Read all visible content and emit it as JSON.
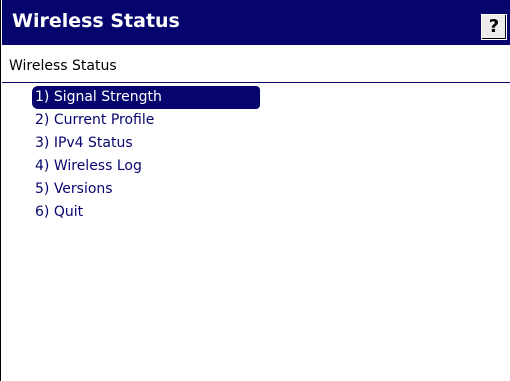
{
  "window": {
    "title": "Wireless Status",
    "help_label": "?"
  },
  "main": {
    "subtitle": "Wireless Status",
    "menu_items": [
      {
        "label": "1) Signal Strength",
        "selected": true
      },
      {
        "label": "2) Current Profile",
        "selected": false
      },
      {
        "label": "3) IPv4 Status",
        "selected": false
      },
      {
        "label": "4) Wireless Log",
        "selected": false
      },
      {
        "label": "5) Versions",
        "selected": false
      },
      {
        "label": "6) Quit",
        "selected": false
      }
    ]
  },
  "colors": {
    "titlebar": "#06056d",
    "menu_text": "#06056d",
    "selection": "#06056d"
  }
}
